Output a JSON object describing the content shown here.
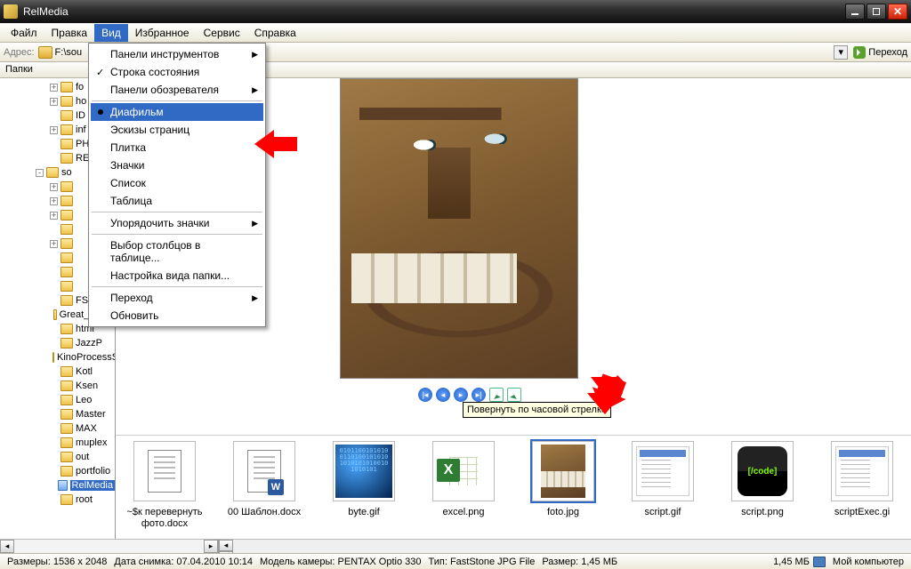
{
  "window": {
    "title": "RelMedia"
  },
  "menubar": {
    "items": [
      "Файл",
      "Правка",
      "Вид",
      "Избранное",
      "Сервис",
      "Справка"
    ],
    "open_index": 2
  },
  "addressbar": {
    "label": "Адрес:",
    "path": "F:\\sou",
    "go_label": "Переход"
  },
  "folders_label": "Папки",
  "view_menu": {
    "items": [
      {
        "label": "Панели инструментов",
        "submenu": true
      },
      {
        "label": "Строка состояния",
        "checked": true
      },
      {
        "label": "Панели обозревателя",
        "submenu": true
      },
      {
        "sep": true
      },
      {
        "label": "Диафильм",
        "hover": true,
        "radio": true
      },
      {
        "label": "Эскизы страниц"
      },
      {
        "label": "Плитка"
      },
      {
        "label": "Значки"
      },
      {
        "label": "Список"
      },
      {
        "label": "Таблица"
      },
      {
        "sep": true
      },
      {
        "label": "Упорядочить значки",
        "submenu": true
      },
      {
        "sep": true
      },
      {
        "label": "Выбор столбцов в таблице..."
      },
      {
        "label": "Настройка вида папки..."
      },
      {
        "sep": true
      },
      {
        "label": "Переход",
        "submenu": true
      },
      {
        "label": "Обновить"
      }
    ]
  },
  "tree": {
    "rows": [
      {
        "indent": 3,
        "twisty": "+",
        "label": "fo"
      },
      {
        "indent": 3,
        "twisty": "+",
        "label": "ho"
      },
      {
        "indent": 3,
        "twisty": " ",
        "label": "ID"
      },
      {
        "indent": 3,
        "twisty": "+",
        "label": "inf"
      },
      {
        "indent": 3,
        "twisty": " ",
        "label": "PH"
      },
      {
        "indent": 3,
        "twisty": " ",
        "label": "RE"
      },
      {
        "indent": 2,
        "twisty": "-",
        "label": "so"
      },
      {
        "indent": 3,
        "twisty": "+",
        "label": ""
      },
      {
        "indent": 3,
        "twisty": "+",
        "label": ""
      },
      {
        "indent": 3,
        "twisty": "+",
        "label": ""
      },
      {
        "indent": 3,
        "twisty": " ",
        "label": ""
      },
      {
        "indent": 3,
        "twisty": "+",
        "label": ""
      },
      {
        "indent": 3,
        "twisty": " ",
        "label": ""
      },
      {
        "indent": 3,
        "twisty": " ",
        "label": ""
      },
      {
        "indent": 3,
        "twisty": " ",
        "label": ""
      },
      {
        "indent": 3,
        "twisty": " ",
        "label": "FS"
      },
      {
        "indent": 3,
        "twisty": " ",
        "label": "Great_Shrek"
      },
      {
        "indent": 3,
        "twisty": " ",
        "label": "html"
      },
      {
        "indent": 3,
        "twisty": " ",
        "label": "JazzP"
      },
      {
        "indent": 3,
        "twisty": " ",
        "label": "KinoProcessSpec"
      },
      {
        "indent": 3,
        "twisty": " ",
        "label": "Kotl"
      },
      {
        "indent": 3,
        "twisty": " ",
        "label": "Ksen"
      },
      {
        "indent": 3,
        "twisty": " ",
        "label": "Leo"
      },
      {
        "indent": 3,
        "twisty": " ",
        "label": "Master"
      },
      {
        "indent": 3,
        "twisty": " ",
        "label": "MAX"
      },
      {
        "indent": 3,
        "twisty": " ",
        "label": "muplex"
      },
      {
        "indent": 3,
        "twisty": " ",
        "label": "out"
      },
      {
        "indent": 3,
        "twisty": " ",
        "label": "portfolio"
      },
      {
        "indent": 3,
        "twisty": " ",
        "label": "RelMedia",
        "selected": true
      },
      {
        "indent": 3,
        "twisty": " ",
        "label": "root"
      }
    ]
  },
  "tooltip": "Повернуть по часовой стрелке",
  "thumbnails": [
    {
      "kind": "doc",
      "label": "~$к перевернуть фото.docx"
    },
    {
      "kind": "docw",
      "label": "00 Шаблон.docx"
    },
    {
      "kind": "byte",
      "label": "byte.gif"
    },
    {
      "kind": "excel",
      "label": "excel.png"
    },
    {
      "kind": "foto",
      "label": "foto.jpg",
      "selected": true
    },
    {
      "kind": "scriptw",
      "label": "script.gif"
    },
    {
      "kind": "script",
      "label": "script.png"
    },
    {
      "kind": "scriptw",
      "label": "scriptExec.gi"
    }
  ],
  "statusbar": {
    "dims": "Размеры: 1536 x 2048",
    "date": "Дата снимка: 07.04.2010 10:14",
    "camera": "Модель камеры: PENTAX Optio 330",
    "type": "Тип: FastStone JPG File",
    "size": "Размер: 1,45 МБ",
    "size2": "1,45 МБ",
    "location": "Мой компьютер"
  }
}
